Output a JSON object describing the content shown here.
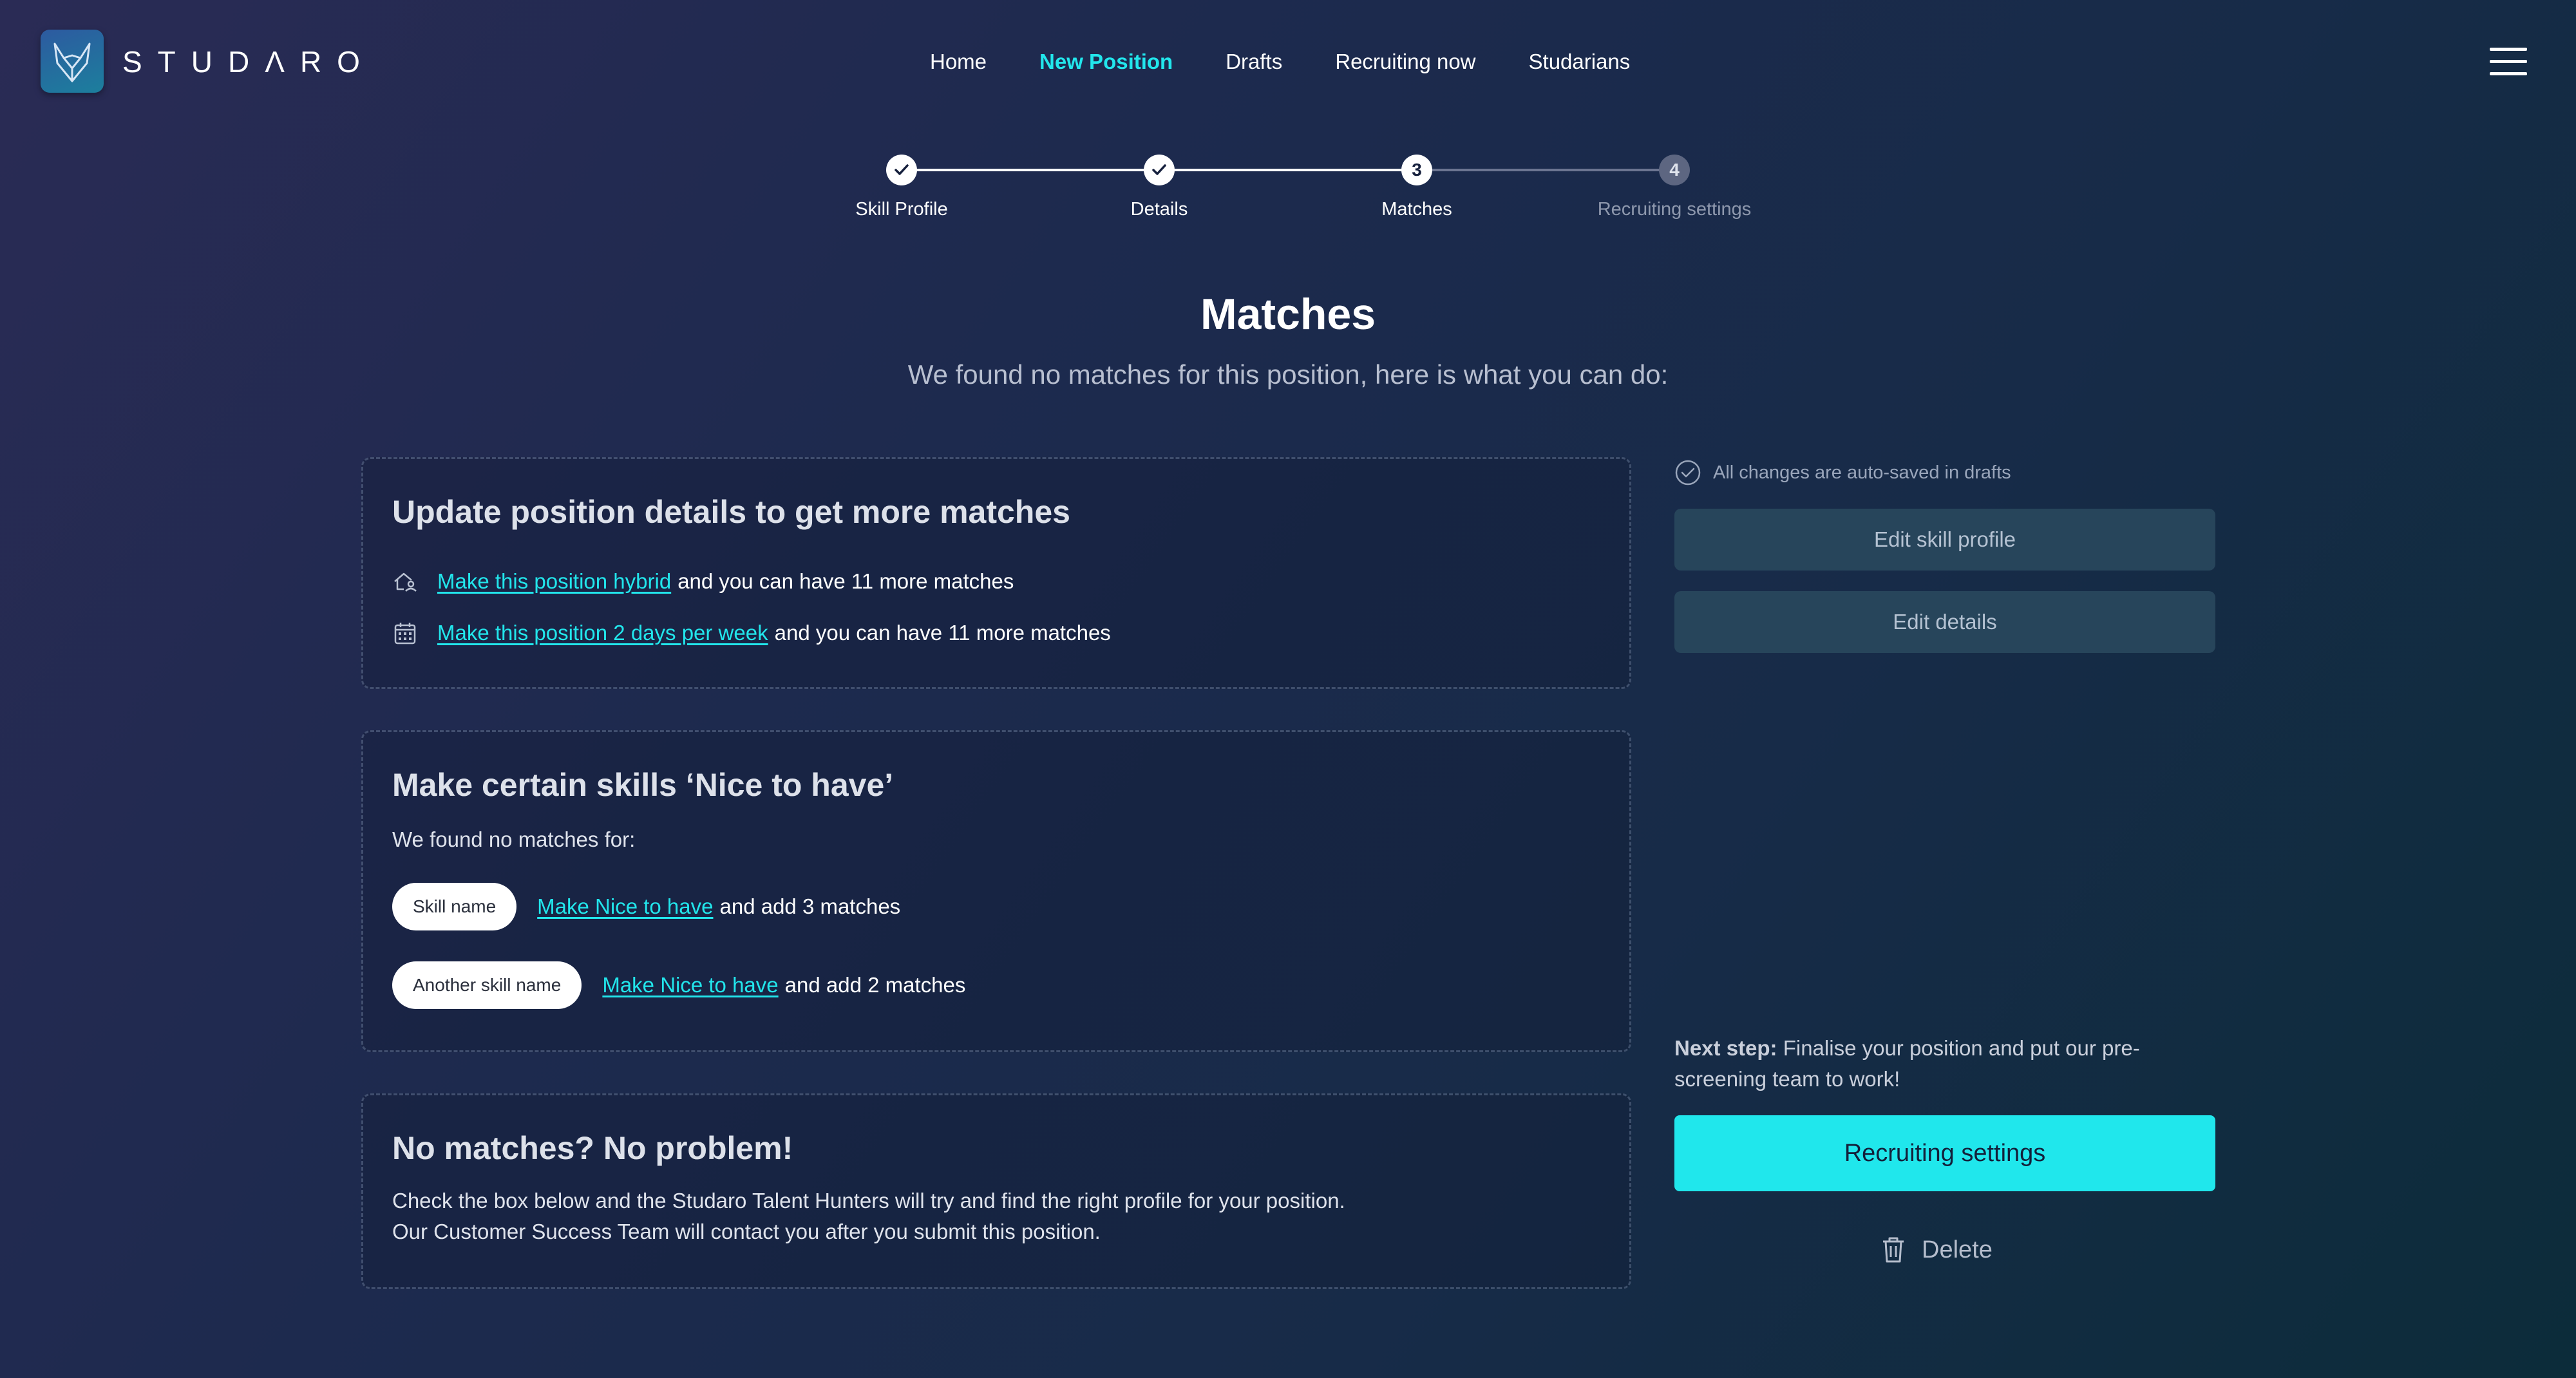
{
  "brand": {
    "logo_text": "STUDΛRO"
  },
  "nav": {
    "items": [
      {
        "label": "Home"
      },
      {
        "label": "New Position"
      },
      {
        "label": "Drafts"
      },
      {
        "label": "Recruiting now"
      },
      {
        "label": "Studarians"
      }
    ]
  },
  "stepper": {
    "steps": [
      {
        "label": "Skill Profile",
        "state": "done"
      },
      {
        "label": "Details",
        "state": "done"
      },
      {
        "label": "Matches",
        "number": "3",
        "state": "current"
      },
      {
        "label": "Recruiting settings",
        "number": "4",
        "state": "upcoming"
      }
    ]
  },
  "page": {
    "title": "Matches",
    "subtitle": "We found no matches for this position, here is what you can do:"
  },
  "card_update": {
    "title": "Update position details to get more matches",
    "rows": [
      {
        "icon": "home-person-icon",
        "link": "Make this position hybrid",
        "text": "and you can have 11 more matches"
      },
      {
        "icon": "calendar-icon",
        "link": "Make this position 2 days per week",
        "text": "and you can have 11 more matches"
      }
    ]
  },
  "card_skills": {
    "title": "Make certain skills ‘Nice to have’",
    "intro": "We found no matches for:",
    "rows": [
      {
        "skill": "Skill name",
        "link": "Make Nice to have",
        "text": "and add 3 matches"
      },
      {
        "skill": "Another skill name",
        "link": "Make Nice to have",
        "text": "and add 2 matches"
      }
    ]
  },
  "card_nomatch": {
    "title": "No matches? No problem!",
    "line1": "Check the box below and the Studaro Talent Hunters will try and find the right profile for your position.",
    "line2": "Our Customer Success Team will contact you after you submit this position."
  },
  "sidebar": {
    "autosave": "All changes are auto-saved in drafts",
    "edit_skill_profile": "Edit skill profile",
    "edit_details": "Edit details",
    "next_step_label": "Next step:",
    "next_step_text": " Finalise your position and put our pre-screening team to work!",
    "recruiting_settings": "Recruiting settings",
    "delete": "Delete"
  },
  "colors": {
    "accent": "#22e6ec",
    "primary_button": "#20e7ec",
    "secondary_button": "#27455b"
  }
}
